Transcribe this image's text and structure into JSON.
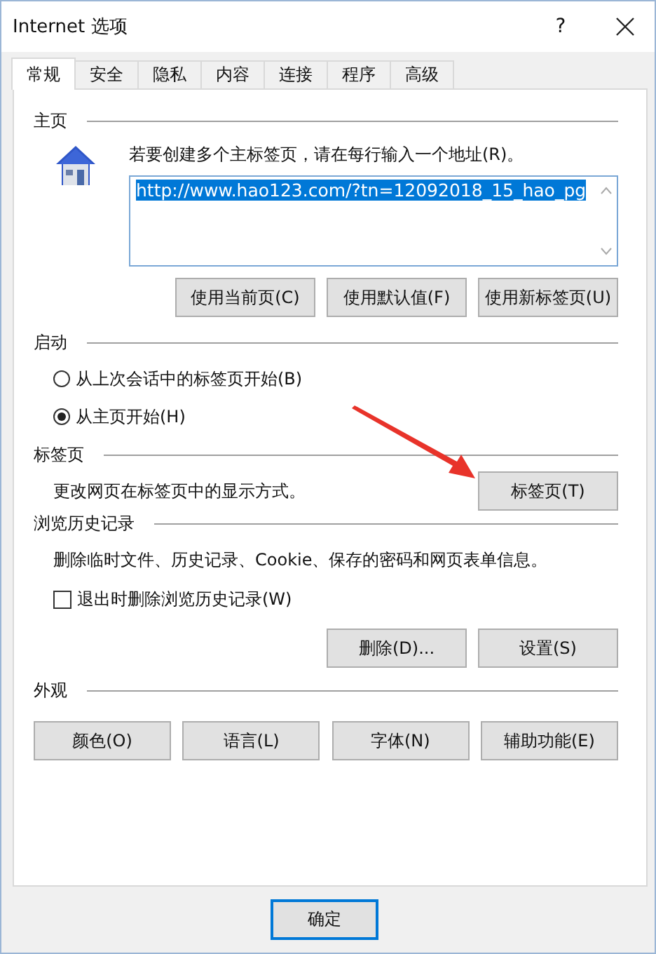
{
  "window": {
    "title": "Internet 选项",
    "help": "?"
  },
  "tabs": [
    {
      "label": "常规",
      "selected": true
    },
    {
      "label": "安全",
      "selected": false
    },
    {
      "label": "隐私",
      "selected": false
    },
    {
      "label": "内容",
      "selected": false
    },
    {
      "label": "连接",
      "selected": false
    },
    {
      "label": "程序",
      "selected": false
    },
    {
      "label": "高级",
      "selected": false
    }
  ],
  "home_page": {
    "heading": "主页",
    "instruction": "若要创建多个主标签页，请在每行输入一个地址(R)。",
    "url": "http://www.hao123.com/?tn=12092018_15_hao_pg",
    "url_selected": true,
    "buttons": [
      "使用当前页(C)",
      "使用默认值(F)",
      "使用新标签页(U)"
    ]
  },
  "startup": {
    "heading": "启动",
    "options": [
      {
        "label": "从上次会话中的标签页开始(B)",
        "selected": false
      },
      {
        "label": "从主页开始(H)",
        "selected": true
      }
    ]
  },
  "tabs_section": {
    "heading": "标签页",
    "description": "更改网页在标签页中的显示方式。",
    "button": "标签页(T)"
  },
  "history": {
    "heading": "浏览历史记录",
    "description": "删除临时文件、历史记录、Cookie、保存的密码和网页表单信息。",
    "checkbox": {
      "label": "退出时删除浏览历史记录(W)",
      "checked": false
    },
    "buttons": [
      "删除(D)...",
      "设置(S)"
    ]
  },
  "appearance": {
    "heading": "外观",
    "buttons": [
      "颜色(O)",
      "语言(L)",
      "字体(N)",
      "辅助功能(E)"
    ]
  },
  "footer_buttons": [
    {
      "label": "确定",
      "default": true
    }
  ]
}
